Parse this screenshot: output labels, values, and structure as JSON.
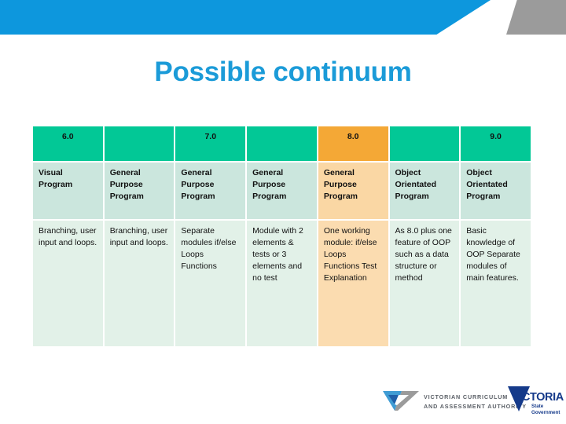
{
  "banner": {
    "blue_color": "#0d97dd",
    "gray_color": "#9b9b9b"
  },
  "title": "Possible continuum",
  "colors": {
    "title": "#1b9bd8",
    "header_teal": "#02c896",
    "header_orange": "#f4a836",
    "cell_mint": "#e2f1e8",
    "cell_mint_dark": "#cbe6dd",
    "cell_peach": "#fad7a4"
  },
  "table": {
    "header": [
      "6.0",
      "",
      "7.0",
      "",
      "8.0",
      "",
      "9.0"
    ],
    "header_highlight_index": 4,
    "rows": [
      {
        "name": "program-type-row",
        "cells": [
          "Visual Program",
          "General Purpose Program",
          "General Purpose Program",
          "General Purpose Program",
          "General Purpose Program",
          "Object Orientated Program",
          "Object Orientated Program"
        ]
      },
      {
        "name": "description-row",
        "cells": [
          "Branching, user input and loops.",
          "Branching, user input and loops.",
          "Separate modules if/else Loops Functions",
          "Module with 2 elements & tests or 3 elements and no test",
          "One working module: if/else Loops Functions Test Explanation",
          "As 8.0 plus one feature of OOP such as a data structure or method",
          "Basic knowledge of OOP Separate modules of main features."
        ]
      }
    ],
    "highlight_column_index": 4
  },
  "footer": {
    "vcaa": {
      "line1": "VICTORIAN CURRICULUM",
      "line2": "AND ASSESSMENT AUTHORITY",
      "mark": "vcaa-checkmark-icon"
    },
    "victoria": {
      "wordmark": "VICTORIA",
      "tagline_line1": "State",
      "tagline_line2": "Government",
      "mark": "victoria-triangle-icon"
    }
  }
}
